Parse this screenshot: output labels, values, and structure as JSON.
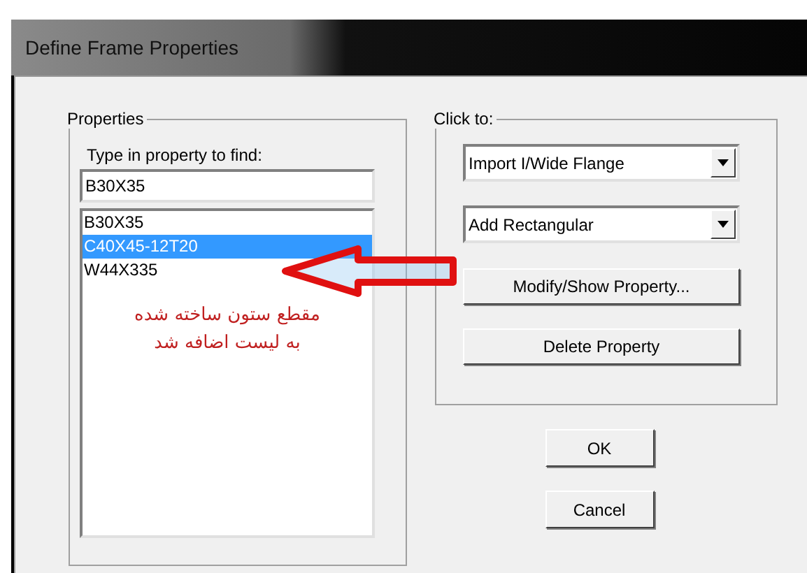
{
  "window": {
    "title": "Define Frame Properties"
  },
  "properties": {
    "legend": "Properties",
    "find_label": "Type in property to find:",
    "find_value": "B30X35",
    "items": [
      {
        "label": "B30X35",
        "selected": false
      },
      {
        "label": "C40X45-12T20",
        "selected": true
      },
      {
        "label": "W44X335",
        "selected": false
      }
    ]
  },
  "annotation": {
    "lines": [
      "مقطع ستون ساخته شده",
      "به لیست اضافه شد"
    ]
  },
  "click_to": {
    "legend": "Click to:",
    "dropdowns": [
      "Import I/Wide Flange",
      "Add Rectangular"
    ],
    "buttons": [
      "Modify/Show Property...",
      "Delete Property"
    ]
  },
  "buttons": [
    "OK",
    "Cancel"
  ]
}
